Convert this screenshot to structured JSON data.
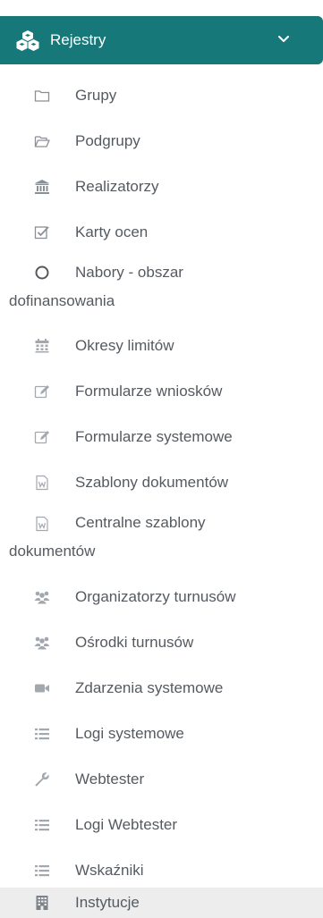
{
  "header": {
    "title": "Rejestry",
    "icon": "cubes-icon",
    "toggle_icon": "chevron-down-icon",
    "bg_color": "#17787a"
  },
  "menu": {
    "items": [
      {
        "label": "Grupy",
        "icon": "folder-icon"
      },
      {
        "label": "Podgrupy",
        "icon": "folder-open-icon"
      },
      {
        "label": "Realizatorzy",
        "icon": "bank-icon"
      },
      {
        "label": "Karty ocen",
        "icon": "check-square-icon"
      },
      {
        "label_line1": "Nabory - obszar",
        "label_line2": "dofinansowania",
        "icon": "circle-icon"
      },
      {
        "label": "Okresy limitów",
        "icon": "calendar-icon"
      },
      {
        "label": "Formularze wniosków",
        "icon": "edit-icon"
      },
      {
        "label": "Formularze systemowe",
        "icon": "edit-icon"
      },
      {
        "label": "Szablony dokumentów",
        "icon": "word-file-icon"
      },
      {
        "label_line1": "Centralne szablony",
        "label_line2": "dokumentów",
        "icon": "word-file-icon"
      },
      {
        "label": "Organizatorzy turnusów",
        "icon": "users-icon"
      },
      {
        "label": "Ośrodki turnusów",
        "icon": "users-icon"
      },
      {
        "label": "Zdarzenia systemowe",
        "icon": "video-camera-icon"
      },
      {
        "label": "Logi systemowe",
        "icon": "list-icon"
      },
      {
        "label": "Webtester",
        "icon": "wrench-icon"
      },
      {
        "label": "Logi Webtester",
        "icon": "list-icon"
      },
      {
        "label": "Wskaźniki",
        "icon": "list-icon"
      },
      {
        "label": "Instytucje",
        "icon": "building-icon",
        "active": true
      }
    ]
  }
}
